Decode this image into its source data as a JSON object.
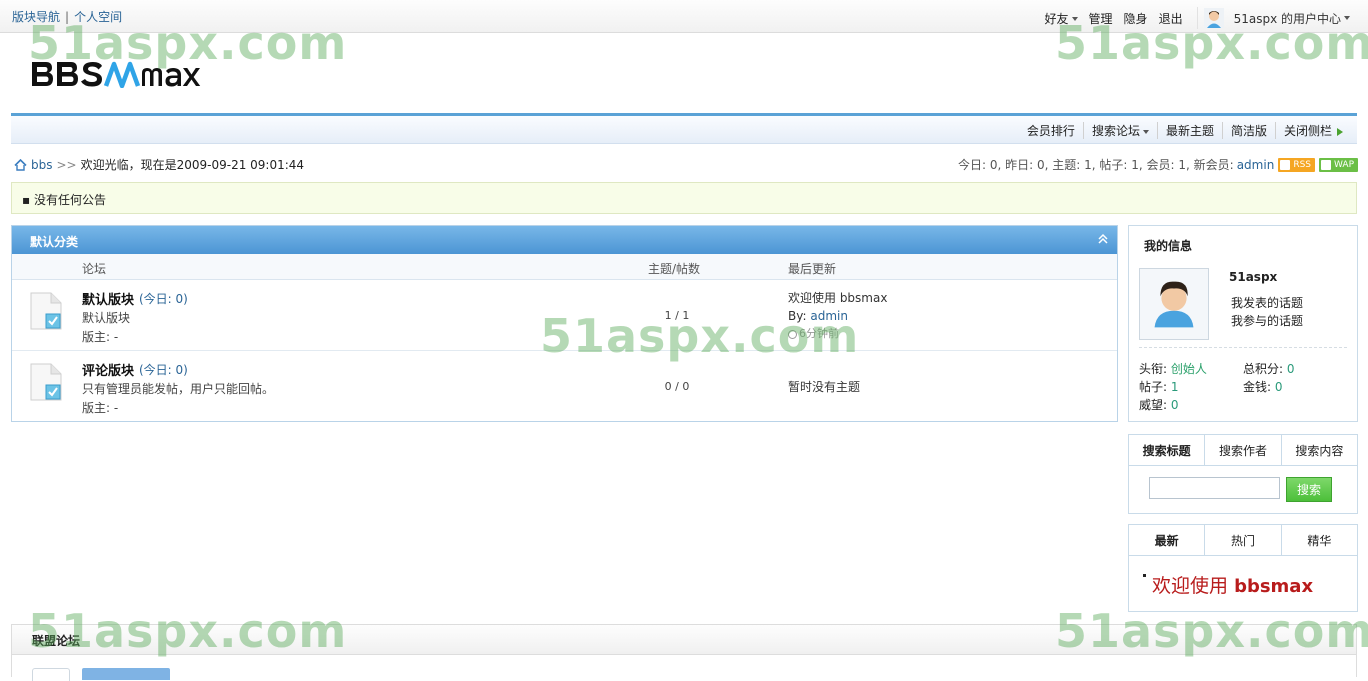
{
  "topbar": {
    "nav1": "版块导航",
    "nav2": "个人空间",
    "friends": "好友",
    "manage": "管理",
    "invisible": "隐身",
    "logout": "退出",
    "user_center": "51aspx 的用户中心"
  },
  "logo": {
    "text": "BBSMAX"
  },
  "subnav": {
    "ranking": "会员排行",
    "search": "搜索论坛",
    "latest": "最新主题",
    "lite": "简洁版",
    "close_sidebar": "关闭侧栏"
  },
  "breadcrumb": {
    "home": "bbs",
    "arrow": ">>",
    "welcome": "欢迎光临，现在是2009-09-21 09:01:44"
  },
  "stats": {
    "text": "今日: 0, 昨日: 0, 主题: 1, 帖子: 1, 会员: 1, 新会员:",
    "new_member": "admin",
    "rss": "RSS",
    "wap": "WAP"
  },
  "notice": {
    "text": "▪  没有任何公告"
  },
  "category": {
    "title": "默认分类",
    "col_forum": "论坛",
    "col_count": "主题/帖数",
    "col_last": "最后更新",
    "forums": [
      {
        "name": "默认版块",
        "today": "(今日: 0)",
        "desc": "默认版块",
        "moderator": "版主: -",
        "count": "1 / 1",
        "last_title": "欢迎使用 bbsmax",
        "last_by_label": "By:",
        "last_by": "admin",
        "last_time": "6分钟前"
      },
      {
        "name": "评论版块",
        "today": "(今日: 0)",
        "desc": "只有管理员能发帖，用户只能回帖。",
        "moderator": "版主: -",
        "count": "0 / 0",
        "last_title": "暂时没有主题"
      }
    ]
  },
  "myinfo": {
    "title": "我的信息",
    "username": "51aspx",
    "my_topics": "我发表的话题",
    "joined_topics": "我参与的话题",
    "rank_label": "头衔:",
    "rank": "创始人",
    "points_label": "总积分:",
    "points": "0",
    "posts_label": "帖子:",
    "posts": "1",
    "money_label": "金钱:",
    "money": "0",
    "prestige_label": "威望:",
    "prestige": "0"
  },
  "search": {
    "tab_title": "搜索标题",
    "tab_author": "搜索作者",
    "tab_content": "搜索内容",
    "input_value": "",
    "button": "搜索"
  },
  "latest_box": {
    "tab_new": "最新",
    "tab_hot": "热门",
    "tab_best": "精华",
    "welcome_text": "欢迎使用",
    "welcome_brand": "bbsmax"
  },
  "alliance": {
    "title": "联盟论坛"
  },
  "watermark": "51aspx.com",
  "colors": {
    "accent_blue": "#4c95d4",
    "link": "#2a6496",
    "button_green": "#4cbf3a",
    "welcome_red": "#b81c1c"
  }
}
